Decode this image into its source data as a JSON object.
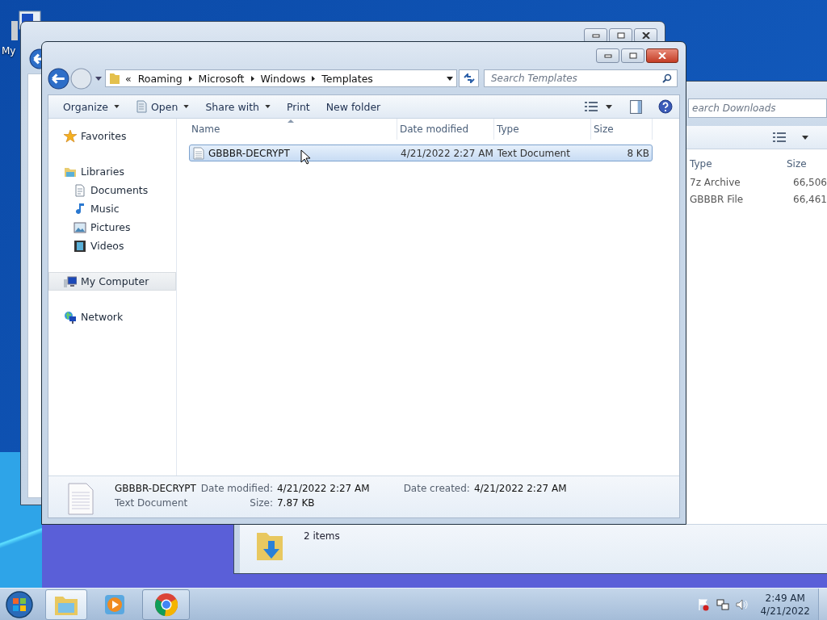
{
  "desktop": {
    "icon_label": "My"
  },
  "downloads_window": {
    "search_placeholder": "earch Downloads",
    "columns": [
      "Type",
      "Size"
    ],
    "rows": [
      {
        "type": "7z Archive",
        "size": "66,506"
      },
      {
        "type": "GBBBR File",
        "size": "66,461"
      }
    ],
    "status": "2 items"
  },
  "explorer": {
    "breadcrumb_overflow": "«",
    "path": [
      "Roaming",
      "Microsoft",
      "Windows",
      "Templates"
    ],
    "search": {
      "placeholder": "Search Templates"
    },
    "toolbar": [
      {
        "label": "Organize",
        "kind": "menu"
      },
      {
        "label": "Open",
        "kind": "open"
      },
      {
        "label": "Share with",
        "kind": "menu"
      },
      {
        "label": "Print",
        "kind": "plain"
      },
      {
        "label": "New folder",
        "kind": "plain"
      }
    ],
    "sidebar": [
      {
        "label": "Favorites",
        "kind": "star",
        "selected": false
      },
      {
        "label": "Libraries",
        "kind": "library",
        "selected": false,
        "children": [
          {
            "label": "Documents",
            "kind": "document",
            "selected": false
          },
          {
            "label": "Music",
            "kind": "music",
            "selected": false
          },
          {
            "label": "Pictures",
            "kind": "pictures",
            "selected": false
          },
          {
            "label": "Videos",
            "kind": "videos",
            "selected": false
          }
        ]
      },
      {
        "label": "My Computer",
        "kind": "computer",
        "selected": true
      },
      {
        "label": "Network",
        "kind": "network",
        "selected": false
      }
    ],
    "columns": [
      {
        "label": "Name",
        "sorted": true
      },
      {
        "label": "Date modified",
        "sorted": false
      },
      {
        "label": "Type",
        "sorted": false
      },
      {
        "label": "Size",
        "sorted": false
      }
    ],
    "files": [
      {
        "name": "GBBBR-DECRYPT",
        "date_modified": "4/21/2022 2:27 AM",
        "type": "Text Document",
        "size": "8 KB",
        "selected": true
      }
    ],
    "details": {
      "name": "GBBBR-DECRYPT",
      "type": "Text Document",
      "modified_label": "Date modified:",
      "modified": "4/21/2022 2:27 AM",
      "size_label": "Size:",
      "size": "7.87 KB",
      "created_label": "Date created:",
      "created": "4/21/2022 2:27 AM"
    }
  },
  "taskbar": {
    "apps": [
      {
        "kind": "explorer",
        "selected": true,
        "running": true
      },
      {
        "kind": "media",
        "selected": false,
        "running": false
      },
      {
        "kind": "chrome",
        "selected": false,
        "running": true
      }
    ],
    "time": "2:49 AM",
    "date": "4/21/2022"
  }
}
